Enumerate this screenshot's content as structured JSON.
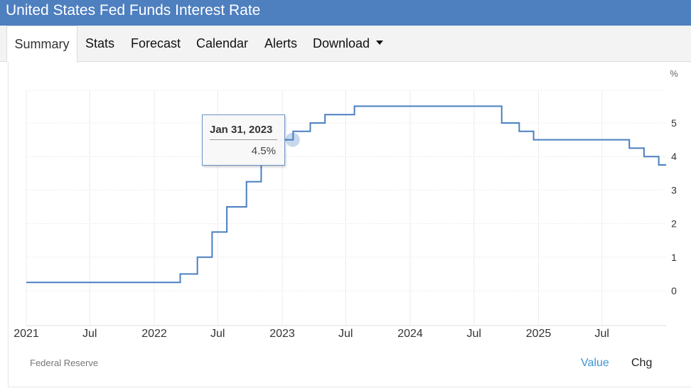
{
  "page": {
    "title": "United States Fed Funds Interest Rate"
  },
  "nav": {
    "tabs": [
      {
        "label": "Summary"
      },
      {
        "label": "Stats"
      },
      {
        "label": "Forecast"
      },
      {
        "label": "Calendar"
      },
      {
        "label": "Alerts"
      },
      {
        "label": "Download"
      }
    ]
  },
  "tooltip": {
    "date": "Jan 31, 2023",
    "value": "4.5%"
  },
  "footer": {
    "source": "Federal Reserve",
    "value_label": "Value",
    "chg_label": "Chg"
  },
  "colors": {
    "header": "#4e7fbf",
    "line": "#4a7fc1",
    "accent": "#3a95d6"
  },
  "chart_data": {
    "type": "line",
    "title": "",
    "xlabel": "",
    "ylabel": "%",
    "ylim": [
      -1,
      6
    ],
    "yticks": [
      0,
      1,
      2,
      3,
      4,
      5
    ],
    "xticks": [
      {
        "date": "2021-01-01",
        "label": "2021"
      },
      {
        "date": "2021-07-01",
        "label": "Jul"
      },
      {
        "date": "2022-01-01",
        "label": "2022"
      },
      {
        "date": "2022-07-01",
        "label": "Jul"
      },
      {
        "date": "2023-01-01",
        "label": "2023"
      },
      {
        "date": "2023-07-01",
        "label": "Jul"
      },
      {
        "date": "2024-01-01",
        "label": "2024"
      },
      {
        "date": "2024-07-01",
        "label": "Jul"
      },
      {
        "date": "2025-01-01",
        "label": "2025"
      },
      {
        "date": "2025-07-01",
        "label": "Jul"
      }
    ],
    "grid": true,
    "step": true,
    "series": [
      {
        "points": [
          [
            "2021-01-01",
            0.25
          ],
          [
            "2022-03-16",
            0.5
          ],
          [
            "2022-05-04",
            1.0
          ],
          [
            "2022-06-15",
            1.75
          ],
          [
            "2022-07-27",
            2.5
          ],
          [
            "2022-09-21",
            3.25
          ],
          [
            "2022-11-02",
            4.0
          ],
          [
            "2022-12-14",
            4.5
          ],
          [
            "2023-02-01",
            4.75
          ],
          [
            "2023-03-22",
            5.0
          ],
          [
            "2023-05-03",
            5.25
          ],
          [
            "2023-07-26",
            5.5
          ],
          [
            "2024-09-18",
            5.0
          ],
          [
            "2024-11-07",
            4.75
          ],
          [
            "2024-12-18",
            4.5
          ],
          [
            "2025-09-17",
            4.25
          ],
          [
            "2025-10-29",
            4.0
          ],
          [
            "2025-12-10",
            3.75
          ]
        ]
      }
    ],
    "highlight": {
      "date": "2023-01-31",
      "value": 4.5
    }
  }
}
